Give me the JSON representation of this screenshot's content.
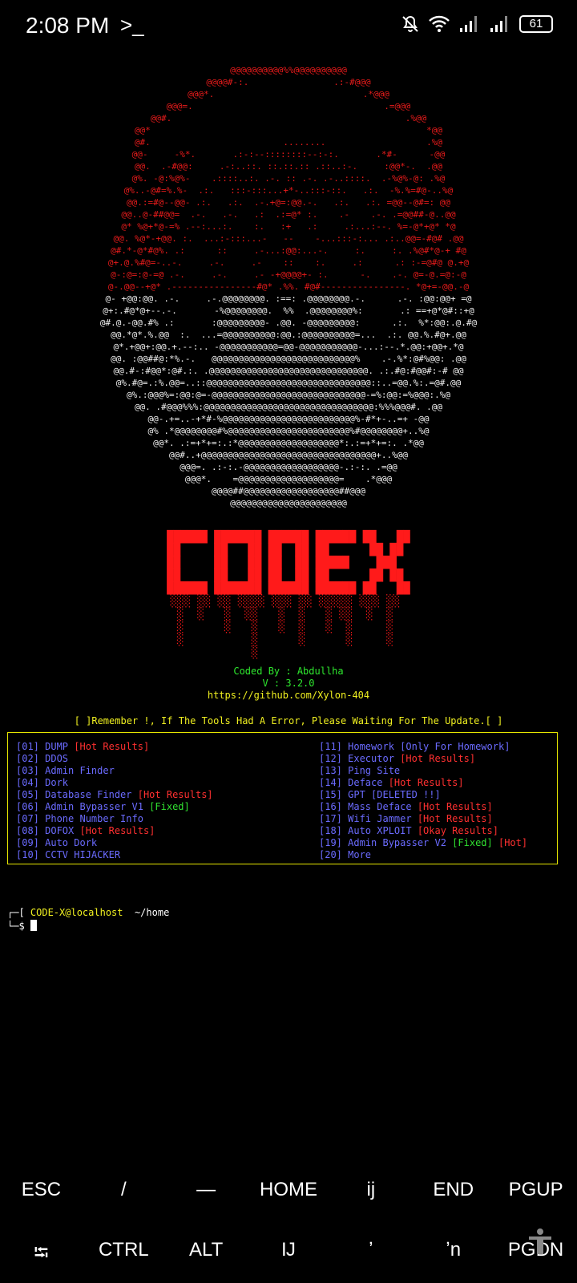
{
  "status_bar": {
    "time": "2:08 PM",
    "terminal_icon": ">_",
    "battery": "61",
    "icons": [
      "bell-off-icon",
      "wifi-icon",
      "signal-icon",
      "signal-icon",
      "battery-icon"
    ]
  },
  "banner": {
    "art_red": "@@@@@@@@@@%%@@@@@@@@@@\n@@@@#-:.                .:-#@@@\n@@@*.                            .*@@@\n@@@=.                                    .=@@@\n@@#.                                            .%@@\n@@*                                                    *@@\n@#.                         ........                   .%@\n@@-     -%*.       .:-:--::::::::--:-:.       .*#-      -@@\n@@.  .-#@@:     .-:..::. ::.::.:: .::..:-.     :@@*-.  .@@\n@%. -@:%@%-    .::::..:. .-. :: .-. .-..::::.  .-%@%-@: .%@\n@%..-@#=%.%-  .:.   :::-:::...+*-..:::-::.   .:.  -%.%=#@-..%@\n@@.:=#@--@@- .:.   .:.  .-.+@=:@@.-.   .:.   .:. =@@--@#=: @@\n@@..@-##@@=  .-.   .-.   .:  .:=@* :.    .-    .-. .=@@##-@..@@\n@* %@+*@-=% .--:...:.    :.   :+   .:     .:...:--. %=-@*+@* *@\n@@. %@*-+@@. :.  ...:-:::...-   --    -...:::-:... .:..@@=-#@# .@@\n@#.*-@*#@%. .:      ::     .-...:@@:...-.     :.     :. .%@#*@-+ #@\n@+.@.%#@=-..-.     .-.     .-    ::    :.     .:      .: :-=@#@ @.+@\n@-:@=:@-=@ .-.     .-.     .- -+@@@@+- :.      -.    .-. @=-@.=@:-@\n@-.@@--+@* .----------------#@* .%%. #@#----------------. *@+=-@@.-@",
    "art_white": "@- +@@:@@. .-.     .-.@@@@@@@@. :==: .@@@@@@@@.-.      .-. :@@:@@+ =@\n@+:.#@*@+--.-.       -%@@@@@@@@.  %%  .@@@@@@@@%:       .: ==+@*@#::+@\n@#.@.-@@.#% .:       :@@@@@@@@@- .@@. -@@@@@@@@@:      .:.  %*:@@:.@.#@\n@@.*@*.%.@@  :.  ...=@@@@@@@@@@:@@.:@@@@@@@@@@=...  .:. @@.%.#@+.@@\n@*.+@@+:@@.+.--:.. -@@@@@@@@@@@=@@-@@@@@@@@@@@-...:--.*.@@:+@@+.*@\n@@. :@@##@:*%.-.   @@@@@@@@@@@@@@@@@@@@@@@@@@@%    .-.%*:@#%@@: .@@\n@@.#-:#@@*:@#.:. .@@@@@@@@@@@@@@@@@@@@@@@@@@@@@@. .:.#@:#@@#:-# @@\n@%.#@=.:%.@@=..::@@@@@@@@@@@@@@@@@@@@@@@@@@@@@@@::..=@@.%:.=@#.@@\n@%.:@@@%=:@@:@=-@@@@@@@@@@@@@@@@@@@@@@@@@@@@@-=%:@@:=%@@@:.%@\n@@. .#@@@%%%:@@@@@@@@@@@@@@@@@@@@@@@@@@@@@@@@:%%%@@@#. .@@\n@@-.+=..-+*#-%@@@@@@@@@@@@@@@@@@@@@@@@@%-#*+-..=+ -@@\n@% .*@@@@@@@@#%@@@@@@@@@@@@@@@@@@@@@@@%#@@@@@@@@+..%@\n@@*. .:=+*+=:.:*@@@@@@@@@@@@@@@@@@@*:.:=+*+=:. .*@@\n@@#..+@@@@@@@@@@@@@@@@@@@@@@@@@@@@@@@@@+..%@@\n@@@=. .:-:.-@@@@@@@@@@@@@@@@@@-.:-:. .=@@\n@@@*.    =@@@@@@@@@@@@@@@@@@@=    .*@@@\n@@@@##@@@@@@@@@@@@@@@@@@##@@@\n@@@@@@@@@@@@@@@@@@@@@@",
    "logo": "██████ ███████ ██████ ██████ ██   ██\n██     ██   ██ ██  ██ ██      ██ ██ \n██     ██   ██ ██  ██ █████    ███  \n██     ██   ██ ██  ██ ██      ██ ██ \n██████ ███████ ██████ ██████ ██   ██\n░░░ ░░ ░░ ░░░░ ░░░ ░░ ░░░░░ ░░░ ░░ \n ░  ░   ░  ░░   ░  ░   ░ ░░  ░  ░  \n ░      ░   ░   ░  ░   ░  ░     ░  \n ░          ░      ░      ░     ░  \n            ░                      ",
    "coded_by": "Coded By : Abdullha",
    "version": "V : 3.2.0",
    "url": "https://github.com/Xylon-404",
    "remember": "[ ]Remember !, If The Tools Had A Error, Please Waiting For The Update.[ ]"
  },
  "menu": {
    "left": [
      {
        "num": "[01]",
        "label": "DUMP",
        "tag": "[Hot Results]",
        "tag_kind": "hot"
      },
      {
        "num": "[02]",
        "label": "DDOS",
        "tag": "",
        "tag_kind": ""
      },
      {
        "num": "[03]",
        "label": "Admin Finder",
        "tag": "",
        "tag_kind": ""
      },
      {
        "num": "[04]",
        "label": "Dork",
        "tag": "",
        "tag_kind": ""
      },
      {
        "num": "[05]",
        "label": "Database Finder",
        "tag": "[Hot Results]",
        "tag_kind": "hot"
      },
      {
        "num": "[06]",
        "label": "Admin Bypasser V1",
        "tag": "[Fixed]",
        "tag_kind": "fixed"
      },
      {
        "num": "[07]",
        "label": "Phone Number Info",
        "tag": "",
        "tag_kind": ""
      },
      {
        "num": "[08]",
        "label": "DOFOX",
        "tag": "[Hot Results]",
        "tag_kind": "hot"
      },
      {
        "num": "[09]",
        "label": "Auto Dork",
        "tag": "",
        "tag_kind": ""
      },
      {
        "num": "[10]",
        "label": "CCTV HIJACKER",
        "tag": "",
        "tag_kind": ""
      }
    ],
    "right": [
      {
        "num": "[11]",
        "label": "Homework",
        "tag": "[Only For Homework]",
        "tag_kind": "other"
      },
      {
        "num": "[12]",
        "label": "Executor",
        "tag": "[Hot Results]",
        "tag_kind": "hot"
      },
      {
        "num": "[13]",
        "label": "Ping Site",
        "tag": "",
        "tag_kind": ""
      },
      {
        "num": "[14]",
        "label": "Deface",
        "tag": "[Hot Results]",
        "tag_kind": "hot"
      },
      {
        "num": "[15]",
        "label": "GPT",
        "tag": "[DELETED !!]",
        "tag_kind": "other"
      },
      {
        "num": "[16]",
        "label": "Mass Deface",
        "tag": "[Hot Results]",
        "tag_kind": "hot"
      },
      {
        "num": "[17]",
        "label": "Wifi Jammer",
        "tag": "[Hot Results]",
        "tag_kind": "hot"
      },
      {
        "num": "[18]",
        "label": "Auto XPLOIT",
        "tag": "[Okay Results]",
        "tag_kind": "hot"
      },
      {
        "num": "[19]",
        "label": "Admin Bypasser V2",
        "tag": "[Fixed]",
        "tag2": "[Hot]",
        "tag_kind": "fixed"
      },
      {
        "num": "[20]",
        "label": "More",
        "tag": "",
        "tag_kind": ""
      }
    ]
  },
  "shell": {
    "open": "┌─[ ",
    "user_host": "CODE-X@localhost",
    "path": "  ~/home",
    "close": "└─$ "
  },
  "extra_keys": {
    "row1": [
      "ESC",
      "/",
      "—",
      "HOME",
      "ĳ",
      "END",
      "PGUP"
    ],
    "row2": [
      "⭾",
      "CTRL",
      "ALT",
      "Ĳ",
      "ʼ",
      "ʼn",
      "PGDN"
    ]
  }
}
